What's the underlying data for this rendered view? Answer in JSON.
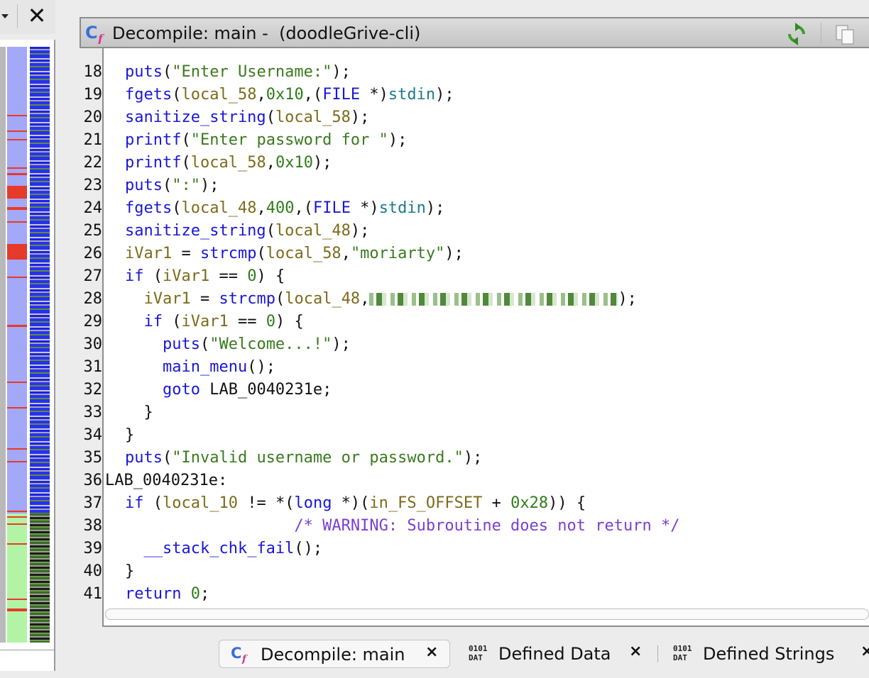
{
  "left_panel": {
    "close_glyph": "✕"
  },
  "header": {
    "title": "Decompile: main -  (doodleGrive-cli)"
  },
  "code": {
    "line_numbers": [
      "18",
      "19",
      "20",
      "21",
      "22",
      "23",
      "24",
      "25",
      "26",
      "27",
      "28",
      "29",
      "30",
      "31",
      "32",
      "33",
      "34",
      "35",
      "36",
      "37",
      "38",
      "39",
      "40",
      "41"
    ],
    "lines": [
      [
        [
          "fn",
          "puts"
        ],
        [
          "p",
          "("
        ],
        [
          "str",
          "\"Enter Username:\""
        ],
        [
          "p",
          ");"
        ]
      ],
      [
        [
          "fn",
          "fgets"
        ],
        [
          "p",
          "("
        ],
        [
          "var",
          "local_58"
        ],
        [
          "p",
          ","
        ],
        [
          "num",
          "0x10"
        ],
        [
          "p",
          ",("
        ],
        [
          "type",
          "FILE"
        ],
        [
          "p",
          " *)"
        ],
        [
          "glb",
          "stdin"
        ],
        [
          "p",
          ");"
        ]
      ],
      [
        [
          "fn",
          "sanitize_string"
        ],
        [
          "p",
          "("
        ],
        [
          "var",
          "local_58"
        ],
        [
          "p",
          ");"
        ]
      ],
      [
        [
          "fn",
          "printf"
        ],
        [
          "p",
          "("
        ],
        [
          "str",
          "\"Enter password for \""
        ],
        [
          "p",
          ");"
        ]
      ],
      [
        [
          "fn",
          "printf"
        ],
        [
          "p",
          "("
        ],
        [
          "var",
          "local_58"
        ],
        [
          "p",
          ","
        ],
        [
          "num",
          "0x10"
        ],
        [
          "p",
          ");"
        ]
      ],
      [
        [
          "fn",
          "puts"
        ],
        [
          "p",
          "("
        ],
        [
          "str",
          "\":\""
        ],
        [
          "p",
          ");"
        ]
      ],
      [
        [
          "fn",
          "fgets"
        ],
        [
          "p",
          "("
        ],
        [
          "var",
          "local_48"
        ],
        [
          "p",
          ","
        ],
        [
          "num",
          "400"
        ],
        [
          "p",
          ",("
        ],
        [
          "type",
          "FILE"
        ],
        [
          "p",
          " *)"
        ],
        [
          "glb",
          "stdin"
        ],
        [
          "p",
          ");"
        ]
      ],
      [
        [
          "fn",
          "sanitize_string"
        ],
        [
          "p",
          "("
        ],
        [
          "var",
          "local_48"
        ],
        [
          "p",
          ");"
        ]
      ],
      [
        [
          "var",
          "iVar1"
        ],
        [
          "p",
          " = "
        ],
        [
          "fn",
          "strcmp"
        ],
        [
          "p",
          "("
        ],
        [
          "var",
          "local_58"
        ],
        [
          "p",
          ","
        ],
        [
          "str",
          "\"moriarty\""
        ],
        [
          "p",
          ");"
        ]
      ],
      [
        [
          "kw",
          "if"
        ],
        [
          "p",
          " ("
        ],
        [
          "var",
          "iVar1"
        ],
        [
          "p",
          " == "
        ],
        [
          "num",
          "0"
        ],
        [
          "p",
          ") {"
        ]
      ],
      [
        [
          "p",
          "  "
        ],
        [
          "var",
          "iVar1"
        ],
        [
          "p",
          " = "
        ],
        [
          "fn",
          "strcmp"
        ],
        [
          "p",
          "("
        ],
        [
          "var",
          "local_48"
        ],
        [
          "p",
          ","
        ],
        [
          "blur",
          ""
        ],
        [
          "p",
          ");"
        ]
      ],
      [
        [
          "p",
          "  "
        ],
        [
          "kw",
          "if"
        ],
        [
          "p",
          " ("
        ],
        [
          "var",
          "iVar1"
        ],
        [
          "p",
          " == "
        ],
        [
          "num",
          "0"
        ],
        [
          "p",
          ") {"
        ]
      ],
      [
        [
          "p",
          "    "
        ],
        [
          "fn",
          "puts"
        ],
        [
          "p",
          "("
        ],
        [
          "str",
          "\"Welcome...!\""
        ],
        [
          "p",
          ");"
        ]
      ],
      [
        [
          "p",
          "    "
        ],
        [
          "fn",
          "main_menu"
        ],
        [
          "p",
          "();"
        ]
      ],
      [
        [
          "p",
          "    "
        ],
        [
          "kw",
          "goto"
        ],
        [
          "p",
          " "
        ],
        [
          "lbl",
          "LAB_0040231e"
        ],
        [
          "p",
          ";"
        ]
      ],
      [
        [
          "p",
          "  }"
        ]
      ],
      [
        [
          "p",
          "}"
        ]
      ],
      [
        [
          "fn",
          "puts"
        ],
        [
          "p",
          "("
        ],
        [
          "str",
          "\"Invalid username or password.\""
        ],
        [
          "p",
          ");"
        ]
      ],
      [
        [
          "lbl",
          "LAB_0040231e:"
        ]
      ],
      [
        [
          "kw",
          "if"
        ],
        [
          "p",
          " ("
        ],
        [
          "var",
          "local_10"
        ],
        [
          "p",
          " != *("
        ],
        [
          "type",
          "long"
        ],
        [
          "p",
          " *)("
        ],
        [
          "var",
          "in_FS_OFFSET"
        ],
        [
          "p",
          " + "
        ],
        [
          "num",
          "0x28"
        ],
        [
          "p",
          ")) {"
        ]
      ],
      [
        [
          "p",
          "                  "
        ],
        [
          "cmt",
          "/* WARNING: Subroutine does not return */"
        ]
      ],
      [
        [
          "p",
          "  "
        ],
        [
          "fn",
          "__stack_chk_fail"
        ],
        [
          "p",
          "();"
        ]
      ],
      [
        [
          "p",
          "}"
        ]
      ],
      [
        [
          "kw",
          "return"
        ],
        [
          "p",
          " "
        ],
        [
          "num",
          "0"
        ],
        [
          "p",
          ";"
        ]
      ]
    ]
  },
  "tabs": [
    {
      "label": "Decompile: main",
      "close": "×"
    },
    {
      "label": "Defined Data",
      "close": "×",
      "icon_text": "0101\nDAT"
    },
    {
      "label": "Defined Strings",
      "close": "×",
      "icon_text": "0101\nDAT"
    }
  ],
  "colors": {
    "function": "#1a17d6",
    "string": "#3a7a1e",
    "variable": "#7d6b1a",
    "comment": "#7a3fd0",
    "global": "#1c7a8c"
  },
  "icons": [
    "decompile-icon",
    "refresh-icon",
    "copy-icon",
    "close-icon",
    "dropdown-arrow-icon",
    "data-icon"
  ]
}
